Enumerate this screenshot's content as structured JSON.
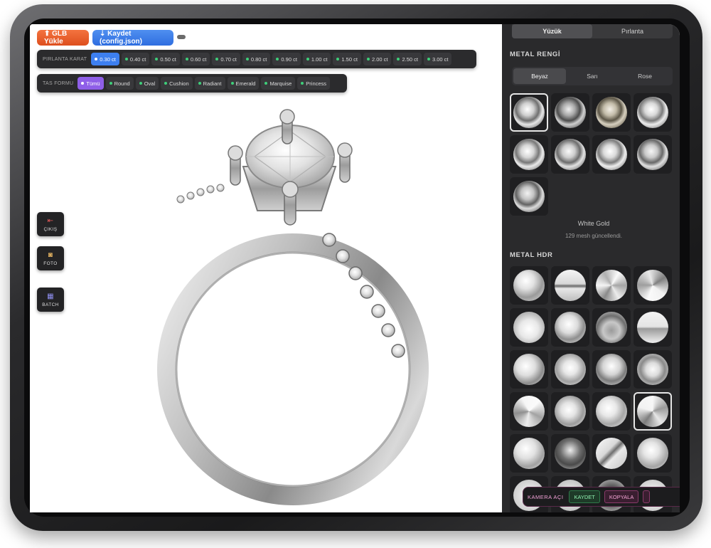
{
  "topbar": {
    "glb_button": "⬆ GLB Yükle",
    "save_button": "⇣ Kaydet (config.json)"
  },
  "carat": {
    "label": "PIRLANTA KARAT",
    "options": [
      "0.30 ct",
      "0.40 ct",
      "0.50 ct",
      "0.60 ct",
      "0.70 ct",
      "0.80 ct",
      "0.90 ct",
      "1.00 ct",
      "1.50 ct",
      "2.00 ct",
      "2.50 ct",
      "3.00 ct"
    ],
    "selected": "0.30 ct"
  },
  "shape": {
    "label": "TAS FORMU",
    "options": [
      "Tümü",
      "Round",
      "Oval",
      "Cushion",
      "Radiant",
      "Emerald",
      "Marquise",
      "Princess"
    ],
    "selected": "Tümü"
  },
  "side_buttons": {
    "exit": "ÇIKIŞ",
    "photo": "FOTO",
    "batch": "BATCH"
  },
  "panel": {
    "tabs": [
      "Yüzük",
      "Pırlanta"
    ],
    "active_tab": "Yüzük",
    "metal_color_title": "METAL RENGİ",
    "metal_colors": [
      "Beyaz",
      "Sarı",
      "Rose"
    ],
    "active_metal_color": "Beyaz",
    "material_name": "White Gold",
    "mesh_status": "129 mesh güncellendi.",
    "hdr_title": "METAL HDR"
  },
  "bottom_bar": {
    "label": "KAMERA AÇI",
    "save": "KAYDET",
    "copy": "KOPYALA"
  },
  "colors": {
    "panel_bg": "#2a2a2c",
    "accent_blue": "#3d7ff0",
    "accent_purple": "#8f5fe8",
    "glb_orange": "#e8582a",
    "save_blue": "#3a7ae8"
  }
}
